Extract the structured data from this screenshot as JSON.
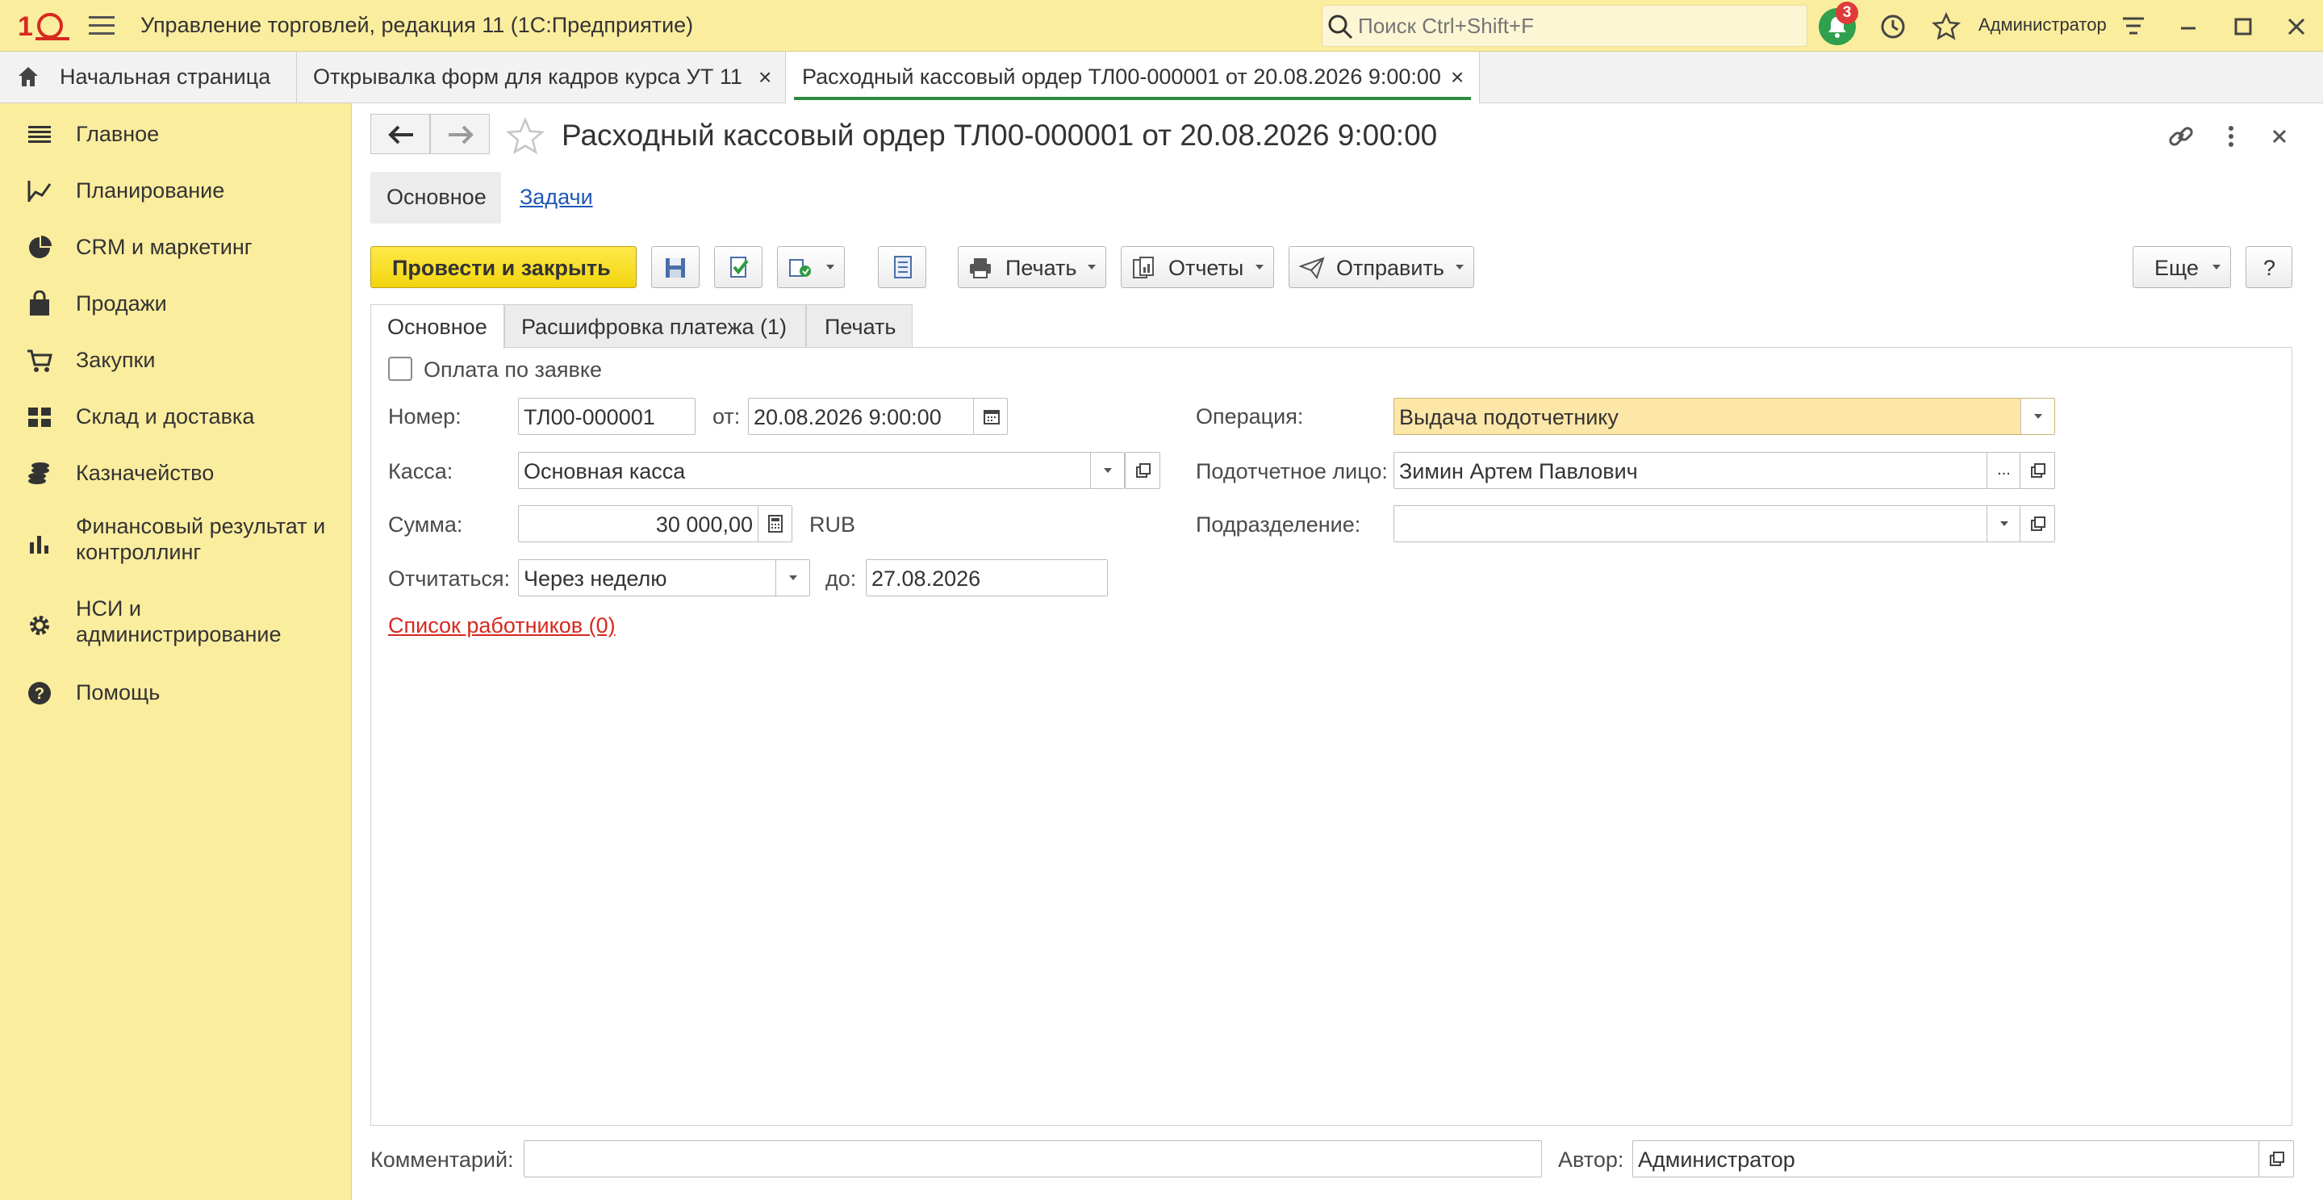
{
  "app": {
    "title": "Управление торговлей, редакция 11  (1С:Предприятие)",
    "search_placeholder": "Поиск Ctrl+Shift+F",
    "notifications_count": "3",
    "user": "Администратор"
  },
  "open_tabs": [
    {
      "label": "Начальная страница"
    },
    {
      "label": "Открывалка форм для кадров курса УТ 11"
    },
    {
      "label": "Расходный кассовый ордер ТЛ00-000001 от 20.08.2026 9:00:00"
    }
  ],
  "sidebar": {
    "items": [
      {
        "label": "Главное",
        "icon": "list-icon"
      },
      {
        "label": "Планирование",
        "icon": "planning-icon"
      },
      {
        "label": "CRM и маркетинг",
        "icon": "pie-chart-icon"
      },
      {
        "label": "Продажи",
        "icon": "bag-icon"
      },
      {
        "label": "Закупки",
        "icon": "cart-icon"
      },
      {
        "label": "Склад и доставка",
        "icon": "warehouse-icon"
      },
      {
        "label": "Казначейство",
        "icon": "coins-icon"
      },
      {
        "label": "Финансовый результат и контроллинг",
        "icon": "bar-chart-icon"
      },
      {
        "label": "НСИ и администрирование",
        "icon": "gear-icon"
      },
      {
        "label": "Помощь",
        "icon": "help-icon"
      }
    ]
  },
  "form": {
    "title": "Расходный кассовый ордер ТЛ00-000001 от 20.08.2026 9:00:00",
    "section_tabs": [
      "Основное",
      "Задачи"
    ],
    "toolbar": {
      "post_close": "Провести и закрыть",
      "print": "Печать",
      "reports": "Отчеты",
      "send": "Отправить",
      "more": "Еще",
      "help": "?"
    },
    "tabs": [
      "Основное",
      "Расшифровка платежа (1)",
      "Печать"
    ],
    "fields": {
      "pay_by_request_label": "Оплата по заявке",
      "number_label": "Номер:",
      "number_value": "ТЛ00-000001",
      "date_label": "от:",
      "date_value": "20.08.2026  9:00:00",
      "kassa_label": "Касса:",
      "kassa_value": "Основная касса",
      "operation_label": "Операция:",
      "operation_value": "Выдача подотчетнику",
      "person_label": "Подотчетное лицо:",
      "person_value": "Зимин Артем Павлович",
      "division_label": "Подразделение:",
      "division_value": "",
      "sum_label": "Сумма:",
      "sum_value": "30 000,00",
      "currency": "RUB",
      "report_label": "Отчитаться:",
      "report_value": "Через неделю",
      "until_label": "до:",
      "until_value": "27.08.2026",
      "workers_link": "Список работников (0)"
    },
    "footer": {
      "comment_label": "Комментарий:",
      "comment_value": "",
      "author_label": "Автор:",
      "author_value": "Администратор"
    }
  },
  "colors": {
    "yellow_bg": "#fbed9e",
    "primary_button": "#f5d916",
    "accent_green": "#2e8b3f",
    "link_blue": "#1f58b8",
    "link_red": "#d6291f",
    "highlight_field": "#fce6a8"
  }
}
